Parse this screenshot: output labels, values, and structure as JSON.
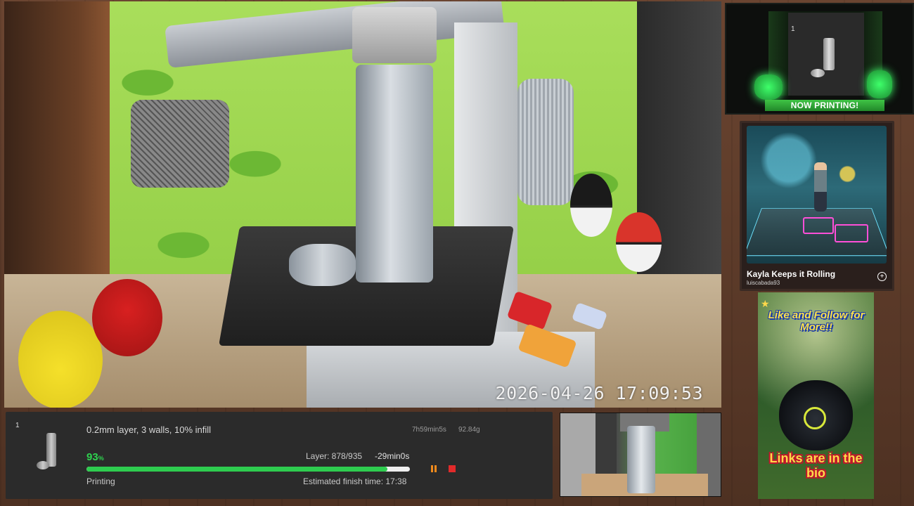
{
  "camera": {
    "timestamp": "2026-04-26  17:09:53"
  },
  "progress_panel": {
    "plate_count": "1",
    "settings": "0.2mm layer, 3 walls, 10% infill",
    "time_estimate": "7h59min5s",
    "filament_weight": "92.84g",
    "percent_value": "93",
    "percent_unit": "%",
    "progress_fraction": 0.93,
    "layer": "Layer: 878/935",
    "remaining": "-29min0s",
    "status": "Printing",
    "finish_time": "Estimated finish time: 17:38",
    "accent_color": "#2ecc4f",
    "pause_icon": "pause-icon",
    "stop_icon": "stop-icon"
  },
  "now_printing": {
    "plate_count": "1",
    "banner": "NOW PRINTING!"
  },
  "music_card": {
    "title": "Kayla Keeps it Rolling",
    "artist": "luiscabada93",
    "add_icon": "plus-circle-icon"
  },
  "promo": {
    "headline": "Like and Follow for More!!",
    "links_text": "Links are in the bio"
  }
}
